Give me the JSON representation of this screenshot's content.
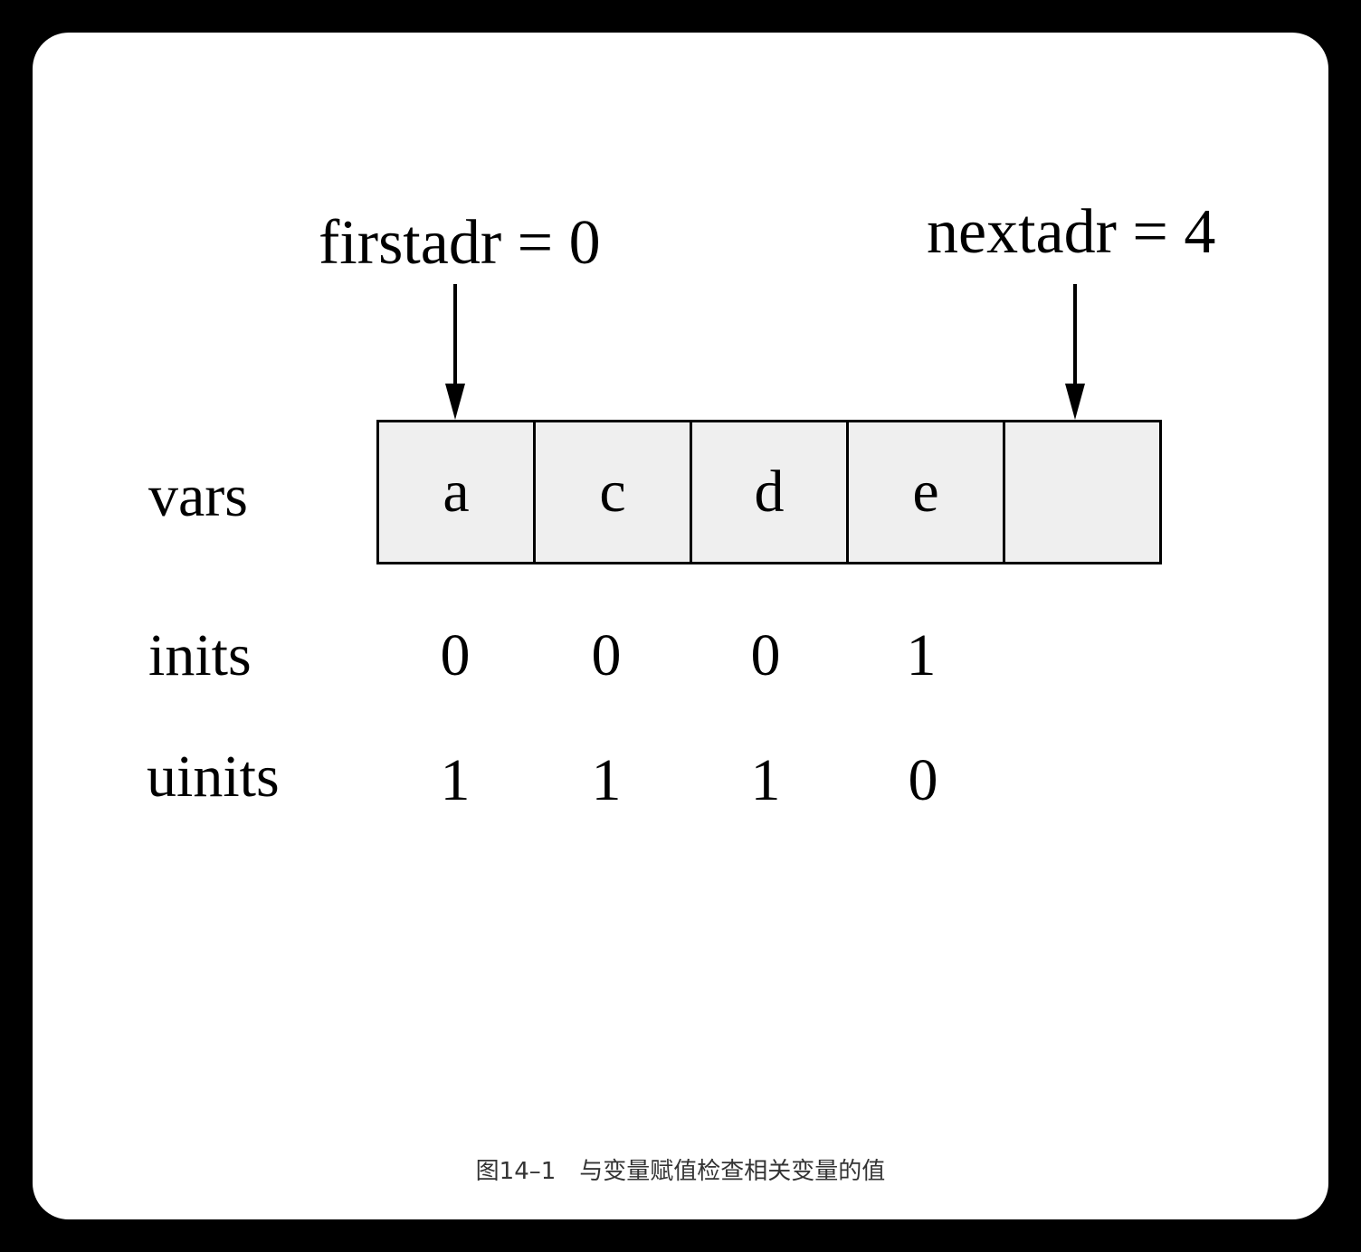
{
  "pointers": {
    "first": "firstadr = 0",
    "next": "nextadr = 4"
  },
  "rows": {
    "vars": "vars",
    "inits": "inits",
    "uinits": "uinits"
  },
  "vars_cells": [
    "a",
    "c",
    "d",
    "e",
    ""
  ],
  "inits_values": [
    "0",
    "0",
    "0",
    "1"
  ],
  "uinits_values": [
    "1",
    "1",
    "1",
    "0"
  ],
  "caption": "图14–1　与变量赋值检查相关变量的值",
  "colors": {
    "background": "#000000",
    "card": "#ffffff",
    "cell_fill": "#efefef",
    "stroke": "#000000"
  }
}
